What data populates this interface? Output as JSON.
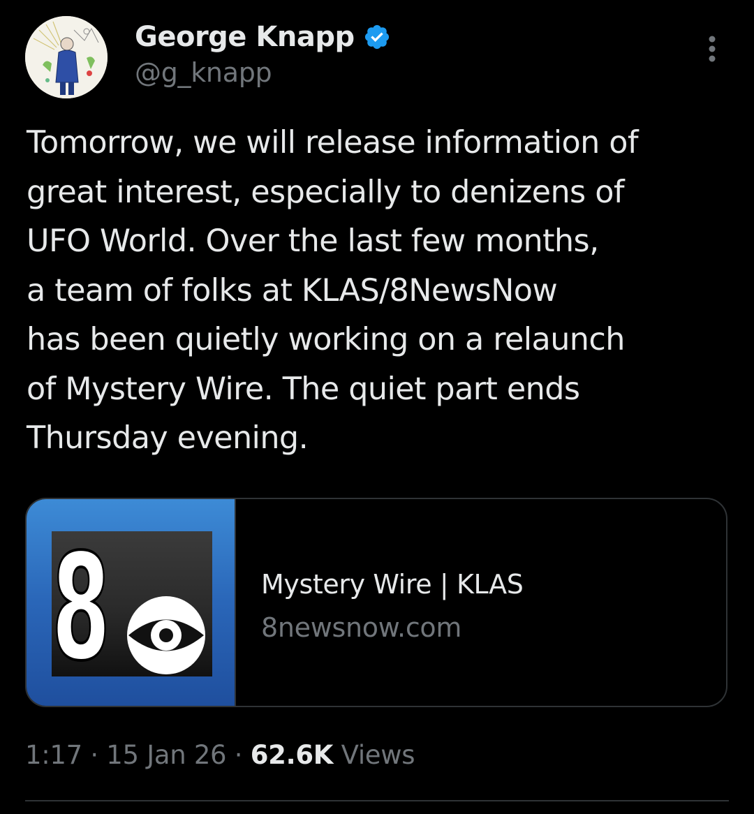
{
  "author": {
    "display_name": "George Knapp",
    "handle": "@g_knapp",
    "verified_color": "#1d9bf0"
  },
  "tweet": {
    "text": "Tomorrow, we will release information of\ngreat interest, especially to denizens of\nUFO World.  Over the last few months,\na team of folks at KLAS/8NewsNow\nhas been quietly working on a relaunch\nof Mystery Wire. The quiet part ends\nThursday evening."
  },
  "card": {
    "thumbnail_icon": "klas-8-cbs-logo",
    "logo_numeral": "8",
    "title": "Mystery Wire | KLAS",
    "domain": "8newsnow.com"
  },
  "meta": {
    "time": "1:17",
    "separator": " · ",
    "date": "15 Jan 26",
    "views_count": "62.6K",
    "views_label": " Views"
  },
  "colors": {
    "background": "#000000",
    "primary_text": "#e7e9ea",
    "secondary_text": "#71767b",
    "border": "#2f3336",
    "accent": "#1d9bf0"
  }
}
